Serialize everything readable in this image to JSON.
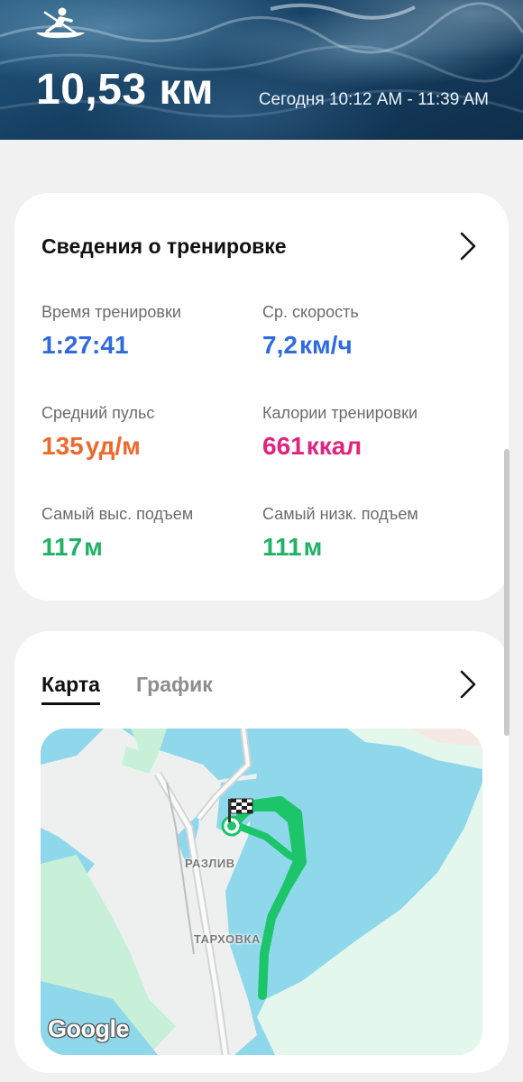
{
  "header": {
    "activity_icon": "rowing-icon",
    "distance": "10,53 км",
    "time_range": "Сегодня 10:12 AM - 11:39 AM"
  },
  "details": {
    "title": "Сведения о тренировке",
    "chevron_icon": "chevron-right-icon",
    "stats": {
      "duration": {
        "label": "Время тренировки",
        "value": "1:27:41",
        "unit": ""
      },
      "avg_speed": {
        "label": "Ср. скорость",
        "value": "7,2",
        "unit": "км/ч"
      },
      "avg_hr": {
        "label": "Средний пульс",
        "value": "135",
        "unit": "уд/м"
      },
      "calories": {
        "label": "Калории тренировки",
        "value": "661",
        "unit": "ккал"
      },
      "max_elev": {
        "label": "Самый выс. подъем",
        "value": "117",
        "unit": "м"
      },
      "min_elev": {
        "label": "Самый низк. подъем",
        "value": "111",
        "unit": "м"
      }
    }
  },
  "map_card": {
    "tabs": [
      "Карта",
      "График"
    ],
    "active_tab": "Карта",
    "chevron_icon": "chevron-right-icon",
    "map": {
      "labels": [
        "РАЗЛИВ",
        "ТАРХОВКА"
      ],
      "attribution": "Google",
      "start_marker_icon": "start-circle-icon",
      "finish_marker_icon": "checkered-flag-icon"
    }
  },
  "colors": {
    "blue": "#2f6bde",
    "orange": "#ec6a2c",
    "pink": "#e0247e",
    "green": "#22b266",
    "route": "#19c26b",
    "water": "#8fd7ea"
  }
}
